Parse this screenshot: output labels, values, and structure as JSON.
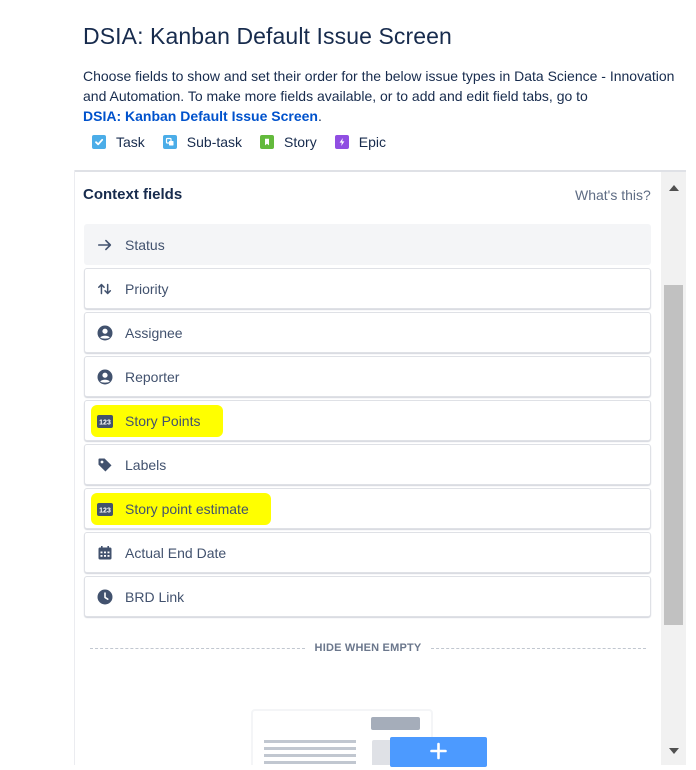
{
  "page": {
    "title": "DSIA: Kanban Default Issue Screen",
    "description_text": "Choose fields to show and set their order for the below issue types in Data Science - Innovation and Automation. To make more fields available, or to add and edit field tabs, go to",
    "description_link": "DSIA: Kanban Default Issue Screen",
    "description_end": "."
  },
  "issue_types": [
    {
      "label": "Task",
      "icon": "task-checkbox-icon",
      "color": "#4bade8"
    },
    {
      "label": "Sub-task",
      "icon": "subtask-icon",
      "color": "#4bade8"
    },
    {
      "label": "Story",
      "icon": "story-bookmark-icon",
      "color": "#63ba3c"
    },
    {
      "label": "Epic",
      "icon": "epic-lightning-icon",
      "color": "#904ee2"
    }
  ],
  "context": {
    "header": "Context fields",
    "help_link": "What's this?",
    "fields": [
      {
        "label": "Status",
        "icon": "arrow-right-icon",
        "locked": true,
        "highlighted": false
      },
      {
        "label": "Priority",
        "icon": "priority-arrows-icon",
        "locked": false,
        "highlighted": false
      },
      {
        "label": "Assignee",
        "icon": "person-circle-icon",
        "locked": false,
        "highlighted": false
      },
      {
        "label": "Reporter",
        "icon": "person-circle-icon",
        "locked": false,
        "highlighted": false
      },
      {
        "label": "Story Points",
        "icon": "number-123-icon",
        "locked": false,
        "highlighted": true
      },
      {
        "label": "Labels",
        "icon": "tag-icon",
        "locked": false,
        "highlighted": false
      },
      {
        "label": "Story point estimate",
        "icon": "number-123-icon",
        "locked": false,
        "highlighted": true
      },
      {
        "label": "Actual End Date",
        "icon": "calendar-icon",
        "locked": false,
        "highlighted": false
      },
      {
        "label": "BRD Link",
        "icon": "clock-icon",
        "locked": false,
        "highlighted": false
      }
    ],
    "hide_when_empty": "HIDE WHEN EMPTY"
  },
  "colors": {
    "highlight": "#ffff00",
    "link": "#0052cc",
    "text": "#172b4d",
    "muted": "#5e6c84",
    "add_button": "#4c9aff"
  }
}
